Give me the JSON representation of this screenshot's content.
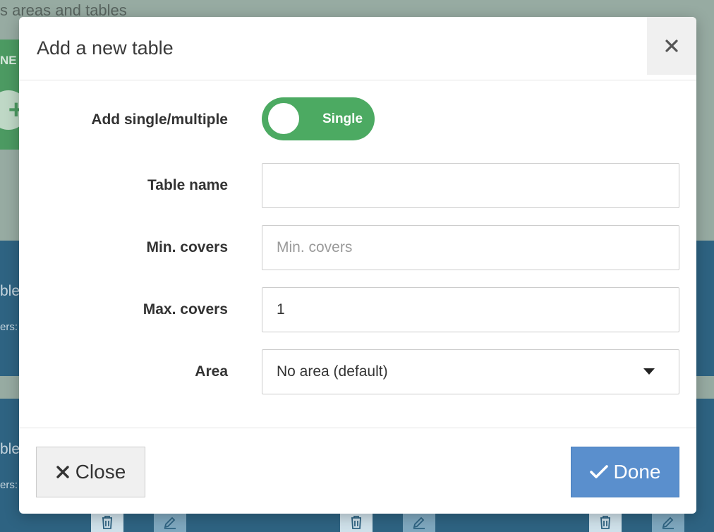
{
  "background": {
    "heading": "s areas and tables",
    "zone_label": "NE",
    "cards": [
      {
        "title": "ble",
        "sub": "ers:"
      },
      {
        "title": "ble",
        "sub": "ers:"
      }
    ]
  },
  "modal": {
    "title": "Add a new table",
    "close_icon": "close-icon",
    "fields": {
      "mode": {
        "label": "Add single/multiple",
        "toggle_text": "Single",
        "toggle_on": true
      },
      "table_name": {
        "label": "Table name",
        "value": "",
        "placeholder": ""
      },
      "min_covers": {
        "label": "Min. covers",
        "value": "",
        "placeholder": "Min. covers"
      },
      "max_covers": {
        "label": "Max. covers",
        "value": "1",
        "placeholder": ""
      },
      "area": {
        "label": "Area",
        "selected": "No area (default)"
      }
    },
    "footer": {
      "close_label": "Close",
      "done_label": "Done"
    }
  },
  "colors": {
    "toggle_green": "#4caa62",
    "done_blue": "#5a8fcd",
    "backdrop_green": "#97aba2",
    "card_blue": "#2e6382"
  }
}
